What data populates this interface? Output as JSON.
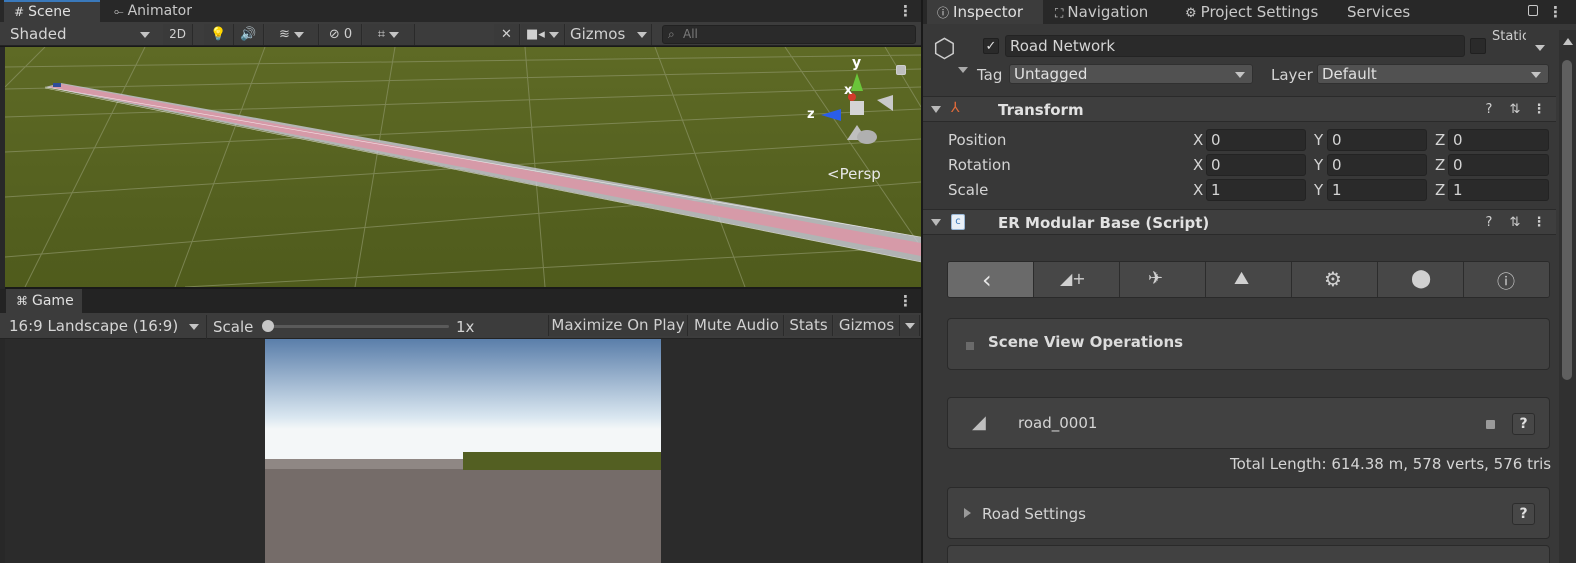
{
  "scene_panel": {
    "tabs": [
      {
        "label": "Scene",
        "icon": "grid-icon"
      },
      {
        "label": "Animator",
        "icon": "animator-icon"
      }
    ],
    "toolbar": {
      "shading_mode": "Shaded",
      "mode_2d": "2D",
      "hidden_count": "0",
      "gizmos": "Gizmos",
      "search_placeholder": "All"
    },
    "orientation": {
      "y": "y",
      "x": "x",
      "z": "z",
      "projection": "Persp"
    }
  },
  "game_panel": {
    "tab": {
      "label": "Game",
      "icon": "gamepad-icon"
    },
    "toolbar": {
      "aspect": "16:9 Landscape (16:9)",
      "scale_label": "Scale",
      "scale_value": "1x",
      "maximize": "Maximize On Play",
      "mute": "Mute Audio",
      "stats": "Stats",
      "gizmos": "Gizmos"
    }
  },
  "inspector": {
    "tabs": [
      {
        "label": "Inspector",
        "icon": "info-icon"
      },
      {
        "label": "Navigation",
        "icon": "navigation-icon"
      },
      {
        "label": "Project Settings",
        "icon": "gear-icon"
      },
      {
        "label": "Services",
        "icon": ""
      }
    ],
    "object": {
      "name": "Road Network",
      "active": true,
      "static_label": "Static",
      "tag_label": "Tag",
      "tag_value": "Untagged",
      "layer_label": "Layer",
      "layer_value": "Default"
    },
    "transform": {
      "title": "Transform",
      "rows": [
        {
          "label": "Position",
          "x": "0",
          "y": "0",
          "z": "0"
        },
        {
          "label": "Rotation",
          "x": "0",
          "y": "0",
          "z": "0"
        },
        {
          "label": "Scale",
          "x": "1",
          "y": "1",
          "z": "1"
        }
      ],
      "axis_labels": [
        "X",
        "Y",
        "Z"
      ]
    },
    "script": {
      "title": "ER Modular Base (Script)",
      "tools": [
        "back-icon",
        "add-road-icon",
        "connection-icon",
        "terrain-icon",
        "settings-icon",
        "prefab-icon",
        "info-icon"
      ],
      "scene_ops_label": "Scene View Operations",
      "road_name": "road_0001",
      "help": "?",
      "total_length": "Total Length: 614.38 m, 578 verts, 576 tris",
      "road_settings": "Road Settings"
    }
  },
  "colors": {
    "accent": "#3a79bb",
    "ground": "#56621f",
    "road": "#d9a0a8",
    "panel": "#383838"
  }
}
